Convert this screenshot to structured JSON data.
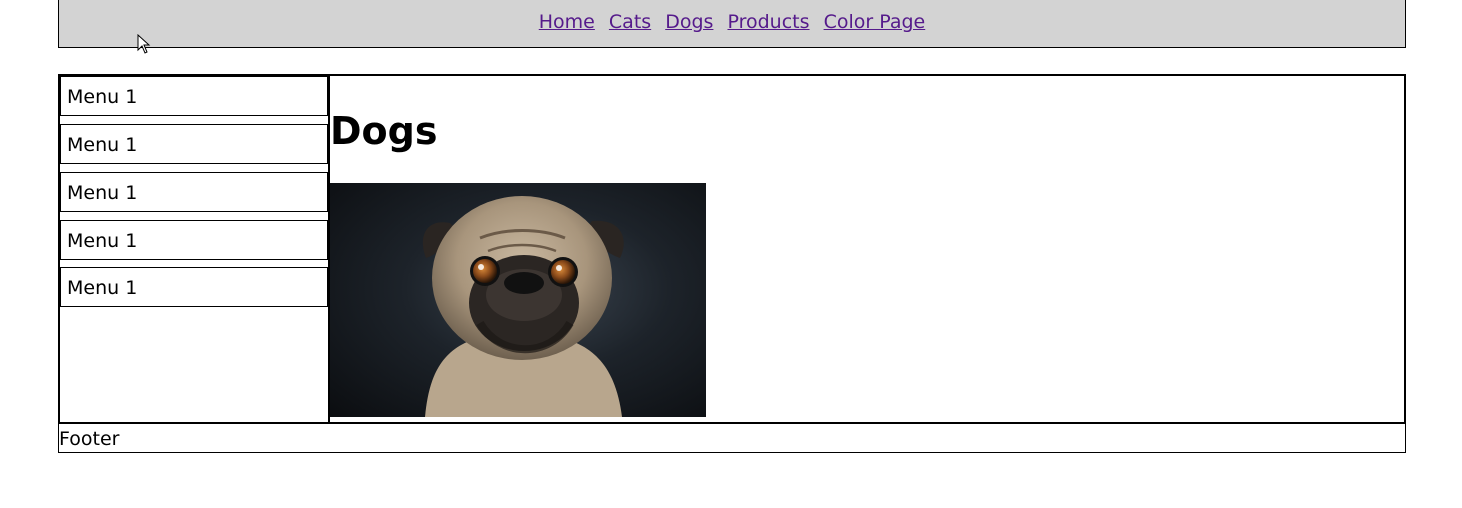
{
  "nav": {
    "links": [
      "Home",
      "Cats",
      "Dogs",
      "Products",
      "Color Page"
    ]
  },
  "sidebar": {
    "items": [
      {
        "label": "Menu 1"
      },
      {
        "label": "Menu 1"
      },
      {
        "label": "Menu 1"
      },
      {
        "label": "Menu 1"
      },
      {
        "label": "Menu 1"
      }
    ]
  },
  "main": {
    "title": "Dogs"
  },
  "footer": {
    "text": "Footer"
  },
  "colors": {
    "header_bg": "#d3d3d3",
    "link": "#551a8b",
    "border": "#000000"
  }
}
